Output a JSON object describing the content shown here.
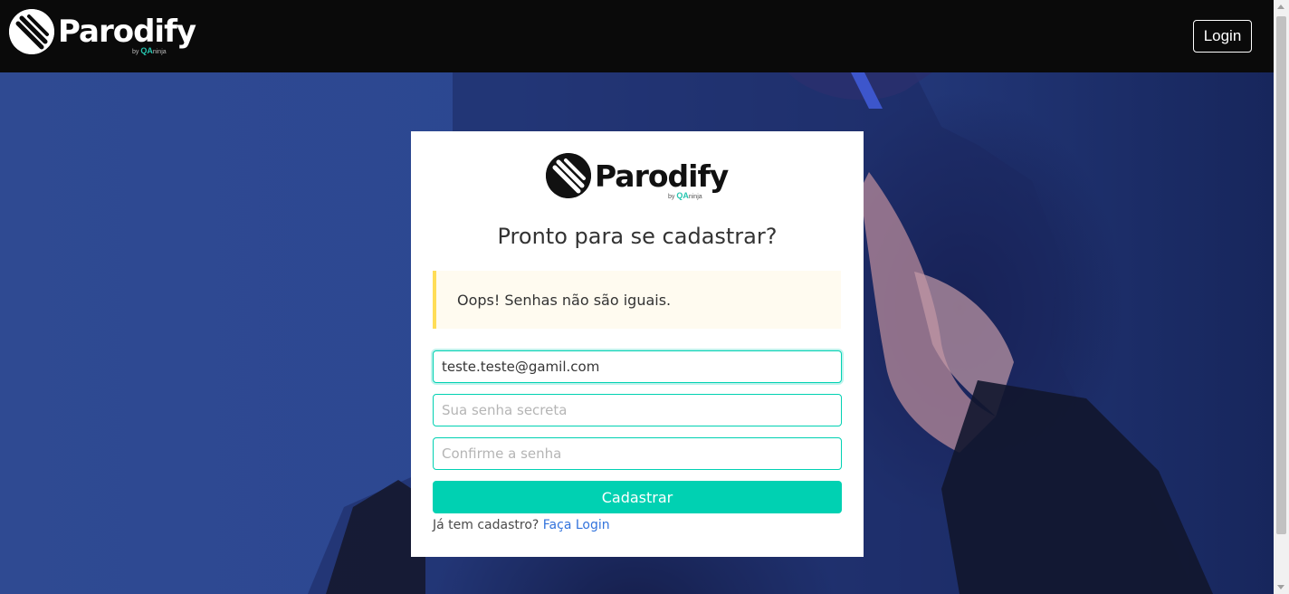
{
  "header": {
    "brand_name": "Parodify",
    "byline_prefix": "by",
    "byline_qa": "QA",
    "byline_suffix": "ninja",
    "login_label": "Login"
  },
  "card": {
    "brand_name": "Parodify",
    "byline_prefix": "by",
    "byline_qa": "QA",
    "byline_suffix": "ninja",
    "title": "Pronto para se cadastrar?",
    "alert_message": "Oops! Senhas não são iguais.",
    "email_value": "teste.teste@gamil.com",
    "password_placeholder": "Sua senha secreta",
    "confirm_placeholder": "Confirme a senha",
    "submit_label": "Cadastrar",
    "footer_text": "Já tem cadastro?",
    "footer_link": "Faça Login"
  },
  "colors": {
    "accent": "#00d1b2",
    "alert_border": "#ffdd57",
    "link": "#3273dc",
    "topbar": "#0a0a0a"
  }
}
